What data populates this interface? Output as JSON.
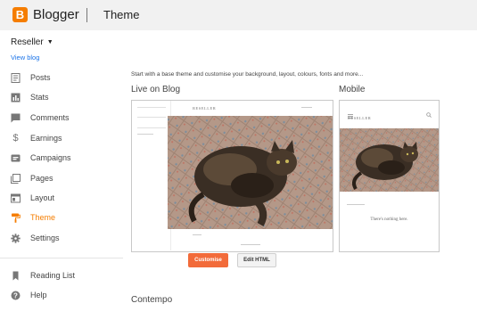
{
  "app": {
    "brand": "Blogger",
    "page_title": "Theme",
    "logo_letter": "B",
    "accent": "#f57d00"
  },
  "sidebar": {
    "blog_name": "Reseller",
    "view_blog": "View blog",
    "items": [
      {
        "label": "Posts",
        "icon": "posts-icon"
      },
      {
        "label": "Stats",
        "icon": "stats-icon"
      },
      {
        "label": "Comments",
        "icon": "comments-icon"
      },
      {
        "label": "Earnings",
        "icon": "dollar-icon"
      },
      {
        "label": "Campaigns",
        "icon": "campaigns-icon"
      },
      {
        "label": "Pages",
        "icon": "pages-icon"
      },
      {
        "label": "Layout",
        "icon": "layout-icon"
      },
      {
        "label": "Theme",
        "icon": "paint-roller-icon",
        "active": true
      },
      {
        "label": "Settings",
        "icon": "gear-icon"
      }
    ],
    "secondary": [
      {
        "label": "Reading List",
        "icon": "bookmark-icon"
      },
      {
        "label": "Help",
        "icon": "help-icon"
      }
    ]
  },
  "main": {
    "intro": "Start with a base theme and customise your background, layout, colours, fonts and more...",
    "live_label": "Live on Blog",
    "mobile_label": "Mobile",
    "preview_blog_title": "RESELLER",
    "mobile_empty_text": "There's nothing here.",
    "customise_button": "Customise",
    "edit_html_button": "Edit HTML",
    "next_theme_label": "Contempo"
  }
}
